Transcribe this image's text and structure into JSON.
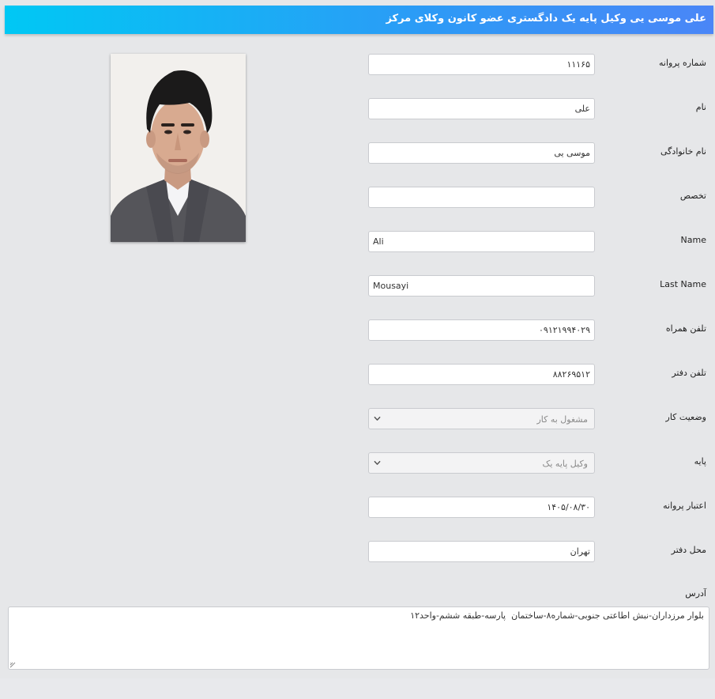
{
  "header": {
    "title": "علی موسی یی وکیل پایه یک دادگستری عضو کانون وکلای مرکز"
  },
  "fields": {
    "license_number": {
      "label": "شماره پروانه",
      "value": "۱۱۱۶۵"
    },
    "first_name": {
      "label": "نام",
      "value": "علی"
    },
    "last_name_fa": {
      "label": "نام خانوادگی",
      "value": "موسی یی"
    },
    "specialty": {
      "label": "تخصص",
      "value": ""
    },
    "name_en": {
      "label": "Name",
      "value": "Ali"
    },
    "last_name_en": {
      "label": "Last Name",
      "value": "Mousayi"
    },
    "mobile": {
      "label": "تلفن همراه",
      "value": "۰۹۱۲۱۹۹۴۰۲۹"
    },
    "office_phone": {
      "label": "تلفن دفتر",
      "value": "۸۸۲۶۹۵۱۲"
    },
    "work_status": {
      "label": "وضعیت کار",
      "value": "مشغول به کار"
    },
    "grade": {
      "label": "پایه",
      "value": "وکیل پایه یک"
    },
    "license_validity": {
      "label": "اعتبار پروانه",
      "value": "۱۴۰۵/۰۸/۳۰"
    },
    "office_location": {
      "label": "محل دفتر",
      "value": "تهران"
    },
    "address": {
      "label": "آدرس",
      "value": "بلوار مرزداران-نبش اطاعتی جنوبی-شماره۸-ساختمان  پارسه-طبقه ششم-واحد۱۲"
    }
  },
  "icons": {
    "select_arrow": "chevron-down-icon",
    "textarea_grip": "resize-grip-icon"
  },
  "colors": {
    "header_start": "#00c8f4",
    "header_end": "#4a86f7"
  }
}
